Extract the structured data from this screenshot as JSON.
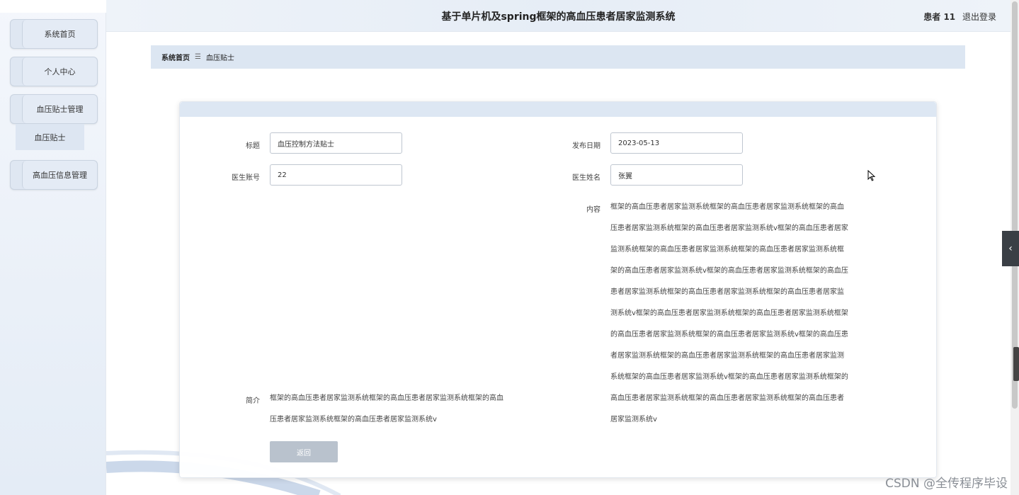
{
  "header": {
    "title": "基于单片机及spring框架的高血压患者居家监测系统",
    "user_name": "患者 11",
    "logout_label": "退出登录"
  },
  "sidebar": {
    "items": [
      {
        "label": "系统首页"
      },
      {
        "label": "个人中心"
      },
      {
        "label": "血压贴士管理"
      },
      {
        "label": "高血压信息管理"
      }
    ],
    "submenu_item": "血压贴士"
  },
  "breadcrumb": {
    "home": "系统首页",
    "separator": "☰",
    "current": "血压贴士"
  },
  "form": {
    "title_label": "标题",
    "title_value": "血压控制方法贴士",
    "date_label": "发布日期",
    "date_value": "2023-05-13",
    "doctor_account_label": "医生账号",
    "doctor_account_value": "22",
    "doctor_name_label": "医生姓名",
    "doctor_name_value": "张翼",
    "content_label": "内容",
    "content_lines": [
      "框架的高血压患者居家监测系统框架的高血压患者居家监测系统框架的高血",
      "压患者居家监测系统框架的高血压患者居家监测系统v框架的高血压患者居家",
      "监测系统框架的高血压患者居家监测系统框架的高血压患者居家监测系统框",
      "架的高血压患者居家监测系统v框架的高血压患者居家监测系统框架的高血压",
      "患者居家监测系统框架的高血压患者居家监测系统框架的高血压患者居家监",
      "测系统v框架的高血压患者居家监测系统框架的高血压患者居家监测系统框架",
      "的高血压患者居家监测系统框架的高血压患者居家监测系统v框架的高血压患",
      "者居家监测系统框架的高血压患者居家监测系统框架的高血压患者居家监测",
      "系统框架的高血压患者居家监测系统v框架的高血压患者居家监测系统框架的",
      "高血压患者居家监测系统框架的高血压患者居家监测系统框架的高血压患者",
      "居家监测系统v"
    ],
    "summary_label": "简介",
    "summary_lines": [
      "框架的高血压患者居家监测系统框架的高血压患者居家监测系统框架的高血",
      "压患者居家监测系统框架的高血压患者居家监测系统v"
    ],
    "back_label": "返回"
  },
  "watermark": "CSDN @全传程序毕设",
  "icons": {
    "side_toggle": "chevron-left-icon",
    "cursor": "mouse-pointer-icon"
  }
}
